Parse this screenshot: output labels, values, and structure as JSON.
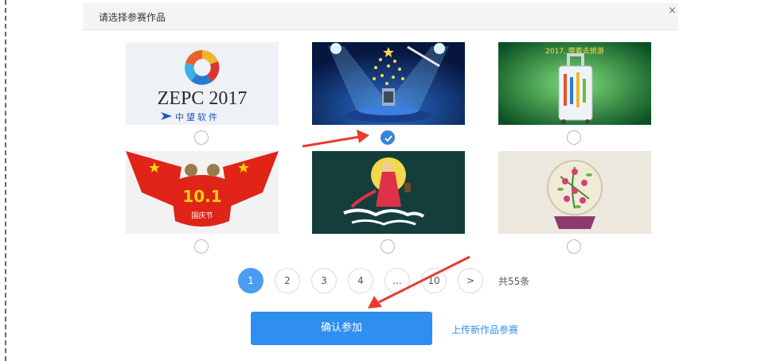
{
  "modal": {
    "title": "请选择参赛作品",
    "close_label": "×"
  },
  "works": [
    {
      "id": "zepc",
      "caption": "ZEPC 2017",
      "subcaption": "中望软件",
      "selected": false
    },
    {
      "id": "stage",
      "selected": true
    },
    {
      "id": "suitcase",
      "caption": "2017, 带着去旅游",
      "selected": false
    },
    {
      "id": "national-day",
      "caption": "10.1",
      "subcaption": "国庆节",
      "selected": false
    },
    {
      "id": "moon-lady",
      "selected": false
    },
    {
      "id": "plate",
      "selected": false
    }
  ],
  "pagination": {
    "pages": [
      "1",
      "2",
      "3",
      "4",
      "...",
      "10",
      ">"
    ],
    "current": "1",
    "total_text": "共55条"
  },
  "actions": {
    "confirm_label": "确认参加",
    "upload_label": "上传新作品参赛"
  },
  "colors": {
    "accent": "#2e8ff0",
    "arrow": "#e83a2f"
  }
}
